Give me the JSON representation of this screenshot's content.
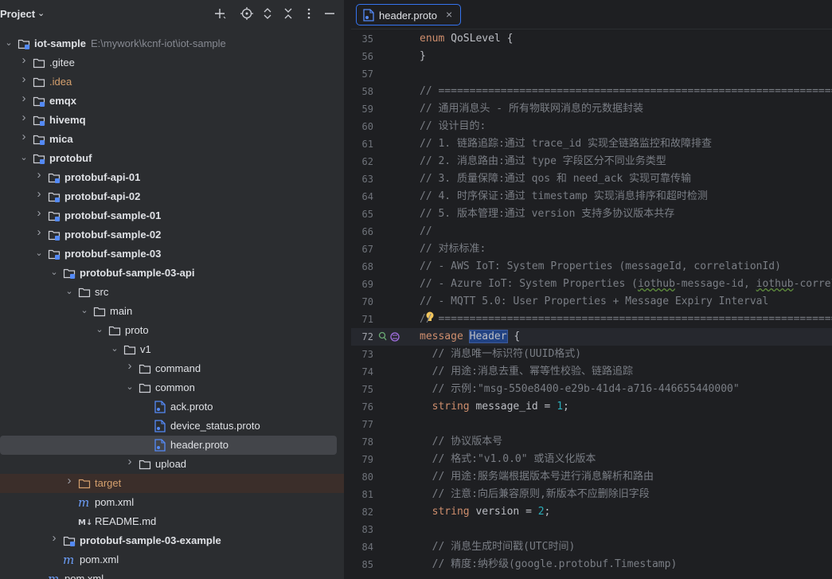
{
  "project_panel": {
    "title": "Project",
    "tree": [
      {
        "depth": 0,
        "expanded": true,
        "type": "module",
        "label": "iot-sample",
        "hint": "E:\\mywork\\kcnf-iot\\iot-sample",
        "bold": true
      },
      {
        "depth": 1,
        "expanded": false,
        "type": "folder",
        "label": ".gitee"
      },
      {
        "depth": 1,
        "expanded": false,
        "type": "folder",
        "label": ".idea",
        "color": "idea"
      },
      {
        "depth": 1,
        "expanded": false,
        "type": "module",
        "label": "emqx",
        "bold": true
      },
      {
        "depth": 1,
        "expanded": false,
        "type": "module",
        "label": "hivemq",
        "bold": true
      },
      {
        "depth": 1,
        "expanded": false,
        "type": "module",
        "label": "mica",
        "bold": true
      },
      {
        "depth": 1,
        "expanded": true,
        "type": "module",
        "label": "protobuf",
        "bold": true
      },
      {
        "depth": 2,
        "expanded": false,
        "type": "module",
        "label": "protobuf-api-01",
        "bold": true
      },
      {
        "depth": 2,
        "expanded": false,
        "type": "module",
        "label": "protobuf-api-02",
        "bold": true
      },
      {
        "depth": 2,
        "expanded": false,
        "type": "module",
        "label": "protobuf-sample-01",
        "bold": true
      },
      {
        "depth": 2,
        "expanded": false,
        "type": "module",
        "label": "protobuf-sample-02",
        "bold": true
      },
      {
        "depth": 2,
        "expanded": true,
        "type": "module",
        "label": "protobuf-sample-03",
        "bold": true
      },
      {
        "depth": 3,
        "expanded": true,
        "type": "module",
        "label": "protobuf-sample-03-api",
        "bold": true
      },
      {
        "depth": 4,
        "expanded": true,
        "type": "folder",
        "label": "src"
      },
      {
        "depth": 5,
        "expanded": true,
        "type": "folder",
        "label": "main"
      },
      {
        "depth": 6,
        "expanded": true,
        "type": "folder",
        "label": "proto"
      },
      {
        "depth": 7,
        "expanded": true,
        "type": "folder",
        "label": "v1"
      },
      {
        "depth": 8,
        "expanded": false,
        "type": "folder",
        "label": "command"
      },
      {
        "depth": 8,
        "expanded": true,
        "type": "folder",
        "label": "common"
      },
      {
        "depth": 9,
        "expanded": null,
        "type": "proto",
        "label": "ack.proto"
      },
      {
        "depth": 9,
        "expanded": null,
        "type": "proto",
        "label": "device_status.proto"
      },
      {
        "depth": 9,
        "expanded": null,
        "type": "proto",
        "label": "header.proto",
        "selected": true
      },
      {
        "depth": 8,
        "expanded": false,
        "type": "folder",
        "label": "upload"
      },
      {
        "depth": 4,
        "expanded": false,
        "type": "folder-orange",
        "label": "target",
        "color": "orange",
        "highlight": true
      },
      {
        "depth": 4,
        "expanded": null,
        "type": "maven",
        "label": "pom.xml"
      },
      {
        "depth": 4,
        "expanded": null,
        "type": "markdown",
        "label": "README.md"
      },
      {
        "depth": 3,
        "expanded": false,
        "type": "module",
        "label": "protobuf-sample-03-example",
        "bold": true
      },
      {
        "depth": 3,
        "expanded": null,
        "type": "maven",
        "label": "pom.xml"
      },
      {
        "depth": 2,
        "expanded": null,
        "type": "maven",
        "label": "pom.xml"
      }
    ]
  },
  "editor": {
    "tab": {
      "label": "header.proto",
      "close": "×"
    },
    "lines": [
      {
        "n": "35",
        "html": "<span class=\"kw\">enum</span> QoSLevel {"
      },
      {
        "n": "56",
        "html": "}"
      },
      {
        "n": "57",
        "html": ""
      },
      {
        "n": "58",
        "html": "<span class=\"cm\">// ===============================================================================</span>"
      },
      {
        "n": "59",
        "html": "<span class=\"cm\">// 通用消息头 - 所有物联网消息的元数据封装</span>"
      },
      {
        "n": "60",
        "html": "<span class=\"cm\">// 设计目的:</span>"
      },
      {
        "n": "61",
        "html": "<span class=\"cm\">// 1. 链路追踪:通过 trace_id 实现全链路监控和故障排查</span>"
      },
      {
        "n": "62",
        "html": "<span class=\"cm\">// 2. 消息路由:通过 type 字段区分不同业务类型</span>"
      },
      {
        "n": "63",
        "html": "<span class=\"cm\">// 3. 质量保障:通过 qos 和 need_ack 实现可靠传输</span>"
      },
      {
        "n": "64",
        "html": "<span class=\"cm\">// 4. 时序保证:通过 timestamp 实现消息排序和超时检测</span>"
      },
      {
        "n": "65",
        "html": "<span class=\"cm\">// 5. 版本管理:通过 version 支持多协议版本共存</span>"
      },
      {
        "n": "66",
        "html": "<span class=\"cm\">//</span>"
      },
      {
        "n": "67",
        "html": "<span class=\"cm\">// 对标标准:</span>"
      },
      {
        "n": "68",
        "html": "<span class=\"cm\">// - AWS IoT: System Properties (messageId, correlationId)</span>"
      },
      {
        "n": "69",
        "html": "<span class=\"cm\">// - Azure IoT: System Properties (<span class=\"squig\">iothub</span>-message-id, <span class=\"squig\">iothub</span>-correlation-id)</span>"
      },
      {
        "n": "70",
        "html": "<span class=\"cm\">// - MQTT 5.0: User Properties + Message Expiry Interval</span>"
      },
      {
        "n": "71",
        "html": "<span class=\"cm\">// ===============================================================================</span>"
      },
      {
        "n": "72",
        "html": "<span class=\"kw\">message</span> <span class=\"cls\">Header</span><span class=\"caret\"></span> {",
        "current": true
      },
      {
        "n": "73",
        "html": "  <span class=\"cm\">// 消息唯一标识符(UUID格式)</span>"
      },
      {
        "n": "74",
        "html": "  <span class=\"cm\">// 用途:消息去重、幂等性校验、链路追踪</span>"
      },
      {
        "n": "75",
        "html": "  <span class=\"cm\">// 示例:\"msg-550e8400-e29b-41d4-a716-446655440000\"</span>"
      },
      {
        "n": "76",
        "html": "  <span class=\"kw\">string</span> message_id = <span class=\"num\">1</span>;"
      },
      {
        "n": "77",
        "html": ""
      },
      {
        "n": "78",
        "html": "  <span class=\"cm\">// 协议版本号</span>"
      },
      {
        "n": "79",
        "html": "  <span class=\"cm\">// 格式:\"v1.0.0\" 或语义化版本</span>"
      },
      {
        "n": "80",
        "html": "  <span class=\"cm\">// 用途:服务端根据版本号进行消息解析和路由</span>"
      },
      {
        "n": "81",
        "html": "  <span class=\"cm\">// 注意:向后兼容原则,新版本不应删除旧字段</span>"
      },
      {
        "n": "82",
        "html": "  <span class=\"kw\">string</span> version = <span class=\"num\">2</span>;"
      },
      {
        "n": "83",
        "html": ""
      },
      {
        "n": "84",
        "html": "  <span class=\"cm\">// 消息生成时间戳(UTC时间)</span>"
      },
      {
        "n": "85",
        "html": "  <span class=\"cm\">// 精度:纳秒级(google.protobuf.Timestamp)</span>"
      }
    ]
  }
}
